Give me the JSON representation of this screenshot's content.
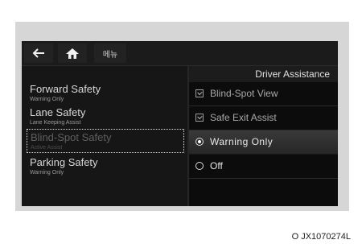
{
  "toolbar": {
    "back_icon": "back-arrow-icon",
    "home_icon": "home-icon",
    "menu_label": "메뉴"
  },
  "categories": [
    {
      "title": "Forward Safety",
      "subtitle": "Warning Only"
    },
    {
      "title": "Lane Safety",
      "subtitle": "Lane Keeping Assist"
    },
    {
      "title": "Blind-Spot Safety",
      "subtitle": "Active Assist"
    },
    {
      "title": "Parking Safety",
      "subtitle": "Warning Only"
    }
  ],
  "panel": {
    "title": "Driver Assistance",
    "options": [
      {
        "label": "Blind-Spot View",
        "type": "checkbox"
      },
      {
        "label": "Safe Exit Assist",
        "type": "checkbox"
      },
      {
        "label": "Warning Only",
        "type": "radio",
        "selected": true
      },
      {
        "label": "Off",
        "type": "radio",
        "selected": false
      }
    ]
  },
  "caption": "O JX1070274L"
}
